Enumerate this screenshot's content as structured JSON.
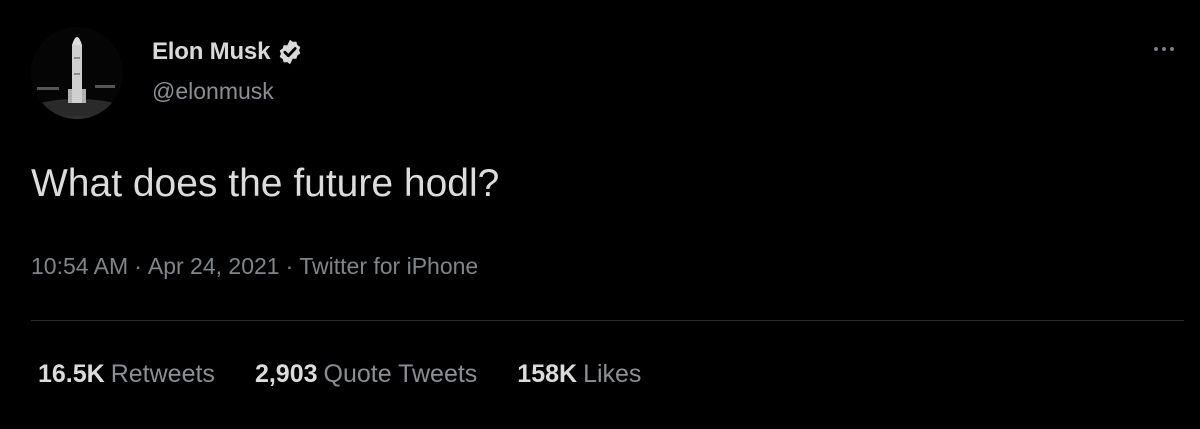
{
  "user": {
    "display_name": "Elon Musk",
    "handle": "@elonmusk",
    "verified_icon": "verified-badge-icon",
    "avatar_icon": "rocket-avatar"
  },
  "tweet": {
    "text": "What does the future hodl?"
  },
  "meta": {
    "time": "10:54 AM",
    "separator": "·",
    "date": "Apr 24, 2021",
    "source": "Twitter for iPhone"
  },
  "stats": [
    {
      "value": "16.5K",
      "label": "Retweets"
    },
    {
      "value": "2,903",
      "label": "Quote Tweets"
    },
    {
      "value": "158K",
      "label": "Likes"
    }
  ],
  "colors": {
    "background": "#000000",
    "primary_text": "#dcdcdc",
    "secondary_text": "#8b8f93",
    "divider": "#2b2e31"
  }
}
